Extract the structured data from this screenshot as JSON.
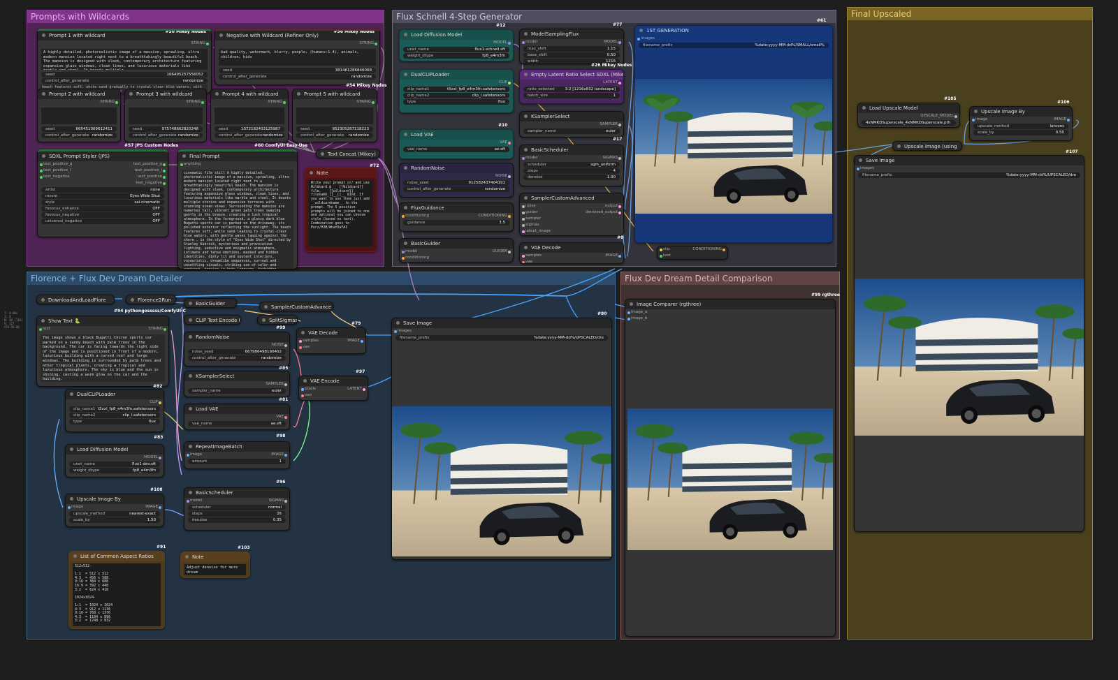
{
  "groups": {
    "wildcards": "Prompts with Wildcards",
    "schnell": "Flux Schnell 4-Step Generator",
    "upscaled": "Final Upscaled",
    "florence": "Florence + Flux Dev Dream Detailer",
    "comparison": "Flux Dev Dream Detail Comparison"
  },
  "n50": {
    "title": "Prompt 1 with wildcard",
    "badge": "#50 Mikey Nodes",
    "out": "STRING",
    "text": "A highly detailed, photorealistic image of a massive, sprawling, ultra-modern mansion located right next to a breathtakingly beautiful beach. The mansion is designed with sleek, contemporary architecture featuring expansive glass windows, clean lines, and luxurious materials like marble and steel. It boasts multiple",
    "seed_l": "seed",
    "seed": "166495257556052",
    "caf_l": "control_after_generate",
    "caf": "randomize",
    "hidden": "beach features soft, white sand gradually to crystal-clear blue waters, with gentle waves lapping against the shore"
  },
  "n56": {
    "title": "Negative with Wildcard (Refiner Only)",
    "badge": "#56 Mikey Nodes",
    "out": "STRING",
    "text": "bad quality, watermark, blurry, people, (humans:1.4), animals, children, kids",
    "seed_l": "seed",
    "seed": "381461286846068",
    "caf_l": "control_after_generate",
    "caf": "randomize",
    "badge2": "#54 Mikey Nodes"
  },
  "p2": {
    "title": "Prompt 2 with wildcard",
    "out": "STRING",
    "seed": "660451069612411",
    "caf": "randomize",
    "seed_l": "seed",
    "caf_l": "control_after_generate"
  },
  "p3": {
    "title": "Prompt 3 with wildcard",
    "out": "STRING",
    "seed": "975748662820348",
    "caf": "randomize",
    "seed_l": "seed",
    "caf_l": "control_after_generate"
  },
  "p4": {
    "title": "Prompt 4 with wildcard",
    "out": "STRING",
    "seed": "1072182403125987",
    "caf": "randomize",
    "seed_l": "seed",
    "caf_l": "control_after_generate"
  },
  "p5": {
    "title": "Prompt 5 with wildcard",
    "out": "STRING",
    "seed": "952305287118223",
    "caf": "randomize",
    "seed_l": "seed",
    "caf_l": "control_after_generate"
  },
  "b57": "#57 JPS Custom Nodes",
  "b60": "#60 ComfyUI Easy Use",
  "styler": {
    "title": "SDXL Prompt Styler (JPS)",
    "ins": [
      "text_positive_g",
      "text_positive_l",
      "text_negative"
    ],
    "outs": [
      "text_positive_g",
      "text_positive_l",
      "text_positive",
      "text_negative"
    ],
    "widgets": [
      [
        "artist",
        "none"
      ],
      [
        "movie",
        "Eyes Wide Shut"
      ],
      [
        "style",
        "sai-cinematic"
      ],
      [
        "fooocus_enhance",
        "OFF"
      ],
      [
        "fooocus_negative",
        "OFF"
      ],
      [
        "universal_negative",
        "OFF"
      ]
    ]
  },
  "finalprompt": {
    "title": "Final Prompt",
    "in": "anything",
    "badge": "#72",
    "text": "cinematic film still A highly detailed, photorealistic image of a massive, sprawling, ultra-modern mansion located right next to a breathtakingly beautiful beach. The mansion is designed with sleek, contemporary architecture featuring expansive glass windows, clean lines, and luxurious materials like marble and steel. It boasts multiple stories and expansive terraces with stunning ocean views. Surrounding the mansion are numerous tall, vibrant green palm trees swaying gently in the breeze, creating a lush tropical atmosphere. In the foreground, a glossy dark blue Bugatti sports car is parked on the driveway, its polished exterior reflecting the sunlight. The beach features soft, white sand leading to crystal-clear blue waters, with gentle waves lapping against the shore , in the style of \"Eyes Wide Shut\" directed by Stanley Kubrick, mysterious and provocative lighting, seductive and enigmatic atmosphere, intimate and tense emotions, masked and hidden identities, dimly lit and opulent interiors, voyeuristic, dreamlike sequences, surreal and unsettling visuals, striking use of color and contrast, tension in body language, forbidden desires, hypnotic and suspenseful ambiance, emotionally charged, a sense of secrecy and obsession, dramatic and ambiguous expressions"
  },
  "concat": {
    "title": "Text Concat (Mikey)"
  },
  "note1": {
    "title": "Note",
    "text": "Write your prompt or/ and use Wildcard @ __ [[Wildcard]] file, __ [[wildcard]] filename_[]__[]__ mind. If you want to use them just add __wildcardname__ to the prompt. The 5 positive prompts will be joined to one and optional you can choose style (based on text). Combination goes to Purz/MJM/WhatDaFAI"
  },
  "loaddiff": {
    "title": "Load Diffusion Model",
    "badge": "#12",
    "out": "MODEL",
    "w": [
      [
        "unet_name",
        "flux1-schnell.sft"
      ],
      [
        "weight_dtype",
        "fp8_e4m3fn"
      ]
    ]
  },
  "dualclip": {
    "title": "DualCLIPLoader",
    "out": "CLIP",
    "w": [
      [
        "clip_name1",
        "t5xxl_fp8_e4m3fn.safetensors"
      ],
      [
        "clip_name2",
        "clip_l.safetensors"
      ],
      [
        "type",
        "flux"
      ]
    ]
  },
  "loadvae": {
    "title": "Load VAE",
    "badge": "#10",
    "out": "VAE",
    "w": [
      [
        "vae_name",
        "ae.sft"
      ]
    ]
  },
  "rnoise": {
    "title": "RandomNoise",
    "out": "NOISE",
    "w": [
      [
        "noise_seed",
        "912582437404191"
      ],
      [
        "control_after_generate",
        "randomize"
      ]
    ]
  },
  "fluxg": {
    "title": "FluxGuidance",
    "in": "conditioning",
    "out": "CONDITIONING",
    "w": [
      [
        "guidance",
        "3.5"
      ]
    ]
  },
  "basicg": {
    "title": "BasicGuider",
    "ins": [
      "model",
      "conditioning"
    ],
    "out": "GUIDER"
  },
  "msf": {
    "title": "ModelSamplingFlux",
    "badge": "#77",
    "in": "model",
    "out": "MODEL",
    "w": [
      [
        "max_shift",
        "1.15"
      ],
      [
        "base_shift",
        "0.50"
      ],
      [
        "width",
        "1216"
      ]
    ],
    "badge2": "#26 Mikey Nodes"
  },
  "latent": {
    "title": "Empty Latent Ratio Select SDXL (Mikey)",
    "out": "LATENT",
    "w": [
      [
        "ratio_selected",
        "3:2 [1216x832 landscape]"
      ],
      [
        "batch_size",
        "1"
      ]
    ],
    "badge": "#13"
  },
  "ksel": {
    "title": "KSamplerSelect",
    "out": "SAMPLER",
    "w": [
      [
        "sampler_name",
        "euler"
      ]
    ],
    "badge": "#17"
  },
  "bsched": {
    "title": "BasicScheduler",
    "in": "model",
    "out": "SIGMAS",
    "w": [
      [
        "scheduler",
        "sgm_uniform"
      ],
      [
        "steps",
        "4"
      ],
      [
        "denoise",
        "1.00"
      ]
    ]
  },
  "sca": {
    "title": "SamplerCustomAdvanced",
    "ins": [
      "noise",
      "guider",
      "sampler",
      "sigmas",
      "latent_image"
    ],
    "outs": [
      "output",
      "denoised_output"
    ],
    "badge": "#8"
  },
  "vaed": {
    "title": "VAE Decode",
    "ins": [
      "samples",
      "vae"
    ],
    "out": "IMAGE"
  },
  "gen1": {
    "title": "1ST GENERATION",
    "badge": "#61",
    "in": "images",
    "w": [
      [
        "filename_prefix",
        "%date:yyyy-MM-dd%/SMALL/small%"
      ]
    ]
  },
  "clipcond": {
    "ins": [
      "clip",
      "text"
    ],
    "out": "CONDITIONING"
  },
  "lum": {
    "title": "Load Upscale Model",
    "badge": "#105",
    "out": "UPSCALE_MODEL",
    "w": [
      [
        "",
        "4xNMKDSuperscale_4xNMKDSuperscale.pth"
      ]
    ]
  },
  "uib106": {
    "title": "Upscale Image By",
    "badge": "#106",
    "in": "image",
    "out": "IMAGE",
    "w": [
      [
        "upscale_method",
        "lanczos"
      ],
      [
        "scale_by",
        "0.50"
      ]
    ]
  },
  "uiu": {
    "title": "Upscale Image (using",
    "ins": [
      "upscale_model",
      "image"
    ]
  },
  "save107": {
    "title": "Save Image",
    "badge": "#107",
    "in": "images",
    "w": [
      [
        "filename_prefix",
        "%date:yyyy-MM-dd%/UPSCALED/dre"
      ]
    ]
  },
  "dlf": {
    "title": "DownloadAndLoadFlore"
  },
  "f2r": {
    "title": "Florence2Run"
  },
  "bg2": {
    "title": "BasicGuider"
  },
  "sca2": {
    "title": "SamplerCustomAdvance"
  },
  "showtext": {
    "title": "Show Text 🐍",
    "in": "text",
    "out": "STRING",
    "badge": "#94 pythongosssss/ComfyUI-C",
    "text": "The image shows a black Bugatti Chiron sports car parked on a sandy beach with palm trees in the background. The car is facing towards the right side of the image and is positioned in front of a modern, luxurious building with a curved roof and large windows. The building is surrounded by palm trees and other tropical plants, creating a tropical and luxurious atmosphere. The sky is blue and the sun is shining, casting a warm glow on the car and the building.",
    "badge2": "#82"
  },
  "cliptext": {
    "title": "CLIP Text Encode (Pr"
  },
  "split": {
    "title": "SplitSigmas"
  },
  "rn2": {
    "title": "RandomNoise",
    "out": "NOISE",
    "badge": "#99",
    "w": [
      [
        "noise_seed",
        "667986498190402"
      ],
      [
        "control_after_generate",
        "randomize"
      ]
    ],
    "badge2": "#85"
  },
  "ks2": {
    "title": "KSamplerSelect",
    "out": "SAMPLER",
    "w": [
      [
        "sampler_name",
        "euler"
      ]
    ],
    "badge": "#81"
  },
  "lv2": {
    "title": "Load VAE",
    "out": "VAE",
    "w": [
      [
        "vae_name",
        "ae.sft"
      ]
    ],
    "badge": "#98"
  },
  "rib": {
    "title": "RepeatImageBatch",
    "in": "image",
    "out": "IMAGE",
    "w": [
      [
        "amount",
        "1"
      ]
    ],
    "badge": "#96"
  },
  "bs2": {
    "title": "BasicScheduler",
    "in": "model",
    "out": "SIGMAS",
    "w": [
      [
        "scheduler",
        "normal"
      ],
      [
        "steps",
        "26"
      ],
      [
        "denoise",
        "0.35"
      ]
    ]
  },
  "vaed2": {
    "title": "VAE Decode",
    "badge": "#79",
    "ins": [
      "samples",
      "vae"
    ],
    "out": "IMAGE"
  },
  "vaee": {
    "title": "VAE Encode",
    "badge": "#97",
    "ins": [
      "pixels",
      "vae"
    ],
    "out": "LATENT"
  },
  "save80": {
    "title": "Save Image",
    "badge": "#80",
    "in": "images",
    "w": [
      [
        "filename_prefix",
        "%date:yyyy-MM-dd%/UPSCALED/dre"
      ]
    ]
  },
  "dc2": {
    "title": "DualCLIPLoader",
    "out": "CLIP",
    "badge": "#83",
    "w": [
      [
        "clip_name1",
        "t5xxl_fp8_e4m3fn.safetensors"
      ],
      [
        "clip_name2",
        "clip_l.safetensors"
      ],
      [
        "type",
        "flux"
      ]
    ]
  },
  "ld2": {
    "title": "Load Diffusion Model",
    "out": "MODEL",
    "badge": "#108",
    "w": [
      [
        "unet_name",
        "flux1-dev.sft"
      ],
      [
        "weight_dtype",
        "fp8_e4m3fn"
      ]
    ]
  },
  "uib108": {
    "title": "Upscale Image By",
    "in": "image",
    "out": "IMAGE",
    "w": [
      [
        "upscale_method",
        "nearest-exact"
      ],
      [
        "scale_by",
        "1.50"
      ]
    ]
  },
  "aspect": {
    "title": "List of Common Aspect Ratios",
    "badge": "#91",
    "text": "512x512-\n\n1:1  = 512 x 512\n4:3  = 456 x 588\n9:16 = 384 x 688\n16:9 = 392 x 448\n3:2  = 624 x 416\n\n1024x1024-\n\n1:1  = 1024 x 1024\n4:3  = 912 x 1136\n9:16 = 768 x 1376\n4:3  = 1184 x 896\n3:2  = 1248 x 832"
  },
  "note103": {
    "title": "Note",
    "badge": "#103",
    "text": "Adjust denoise for more dream"
  },
  "imgcmp": {
    "title": "Image Comparer (rgthree)",
    "badge": "#99 rgthree",
    "ins": [
      "image_a",
      "image_b"
    ]
  },
  "stats": [
    "T: 0.00s",
    "I: 0",
    "N: 89 [110]",
    "V: 127",
    "FPS:56.00"
  ],
  "colors": {
    "green": "#2a6b3a",
    "purple": "#5b2a78",
    "teal": "#1c6a66",
    "blue": "#273d7a",
    "brown": "#5a3f1f",
    "red": "#6a1c1c"
  }
}
